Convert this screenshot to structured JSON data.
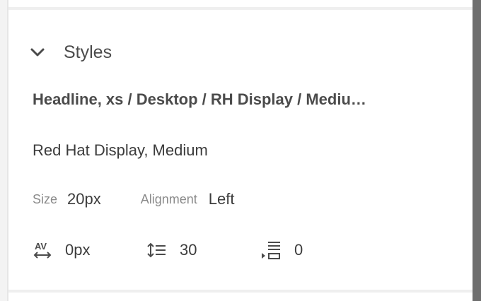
{
  "section": {
    "title": "Styles",
    "expanded_icon": "chevron-down-icon"
  },
  "style": {
    "name": "Headline, xs / Desktop / RH Display / Mediu…",
    "font": "Red Hat Display, Medium"
  },
  "properties": {
    "size_label": "Size",
    "size_value": "20px",
    "alignment_label": "Alignment",
    "alignment_value": "Left"
  },
  "metrics": {
    "letter_spacing": {
      "icon": "letter-spacing-icon",
      "value": "0px"
    },
    "line_height": {
      "icon": "line-height-icon",
      "value": "30"
    },
    "paragraph_spacing": {
      "icon": "paragraph-spacing-icon",
      "value": "0"
    }
  },
  "colors": {
    "text_primary": "#3c3c3c",
    "text_label": "#8a8a8a",
    "scrollbar": "#6e6e6e"
  }
}
